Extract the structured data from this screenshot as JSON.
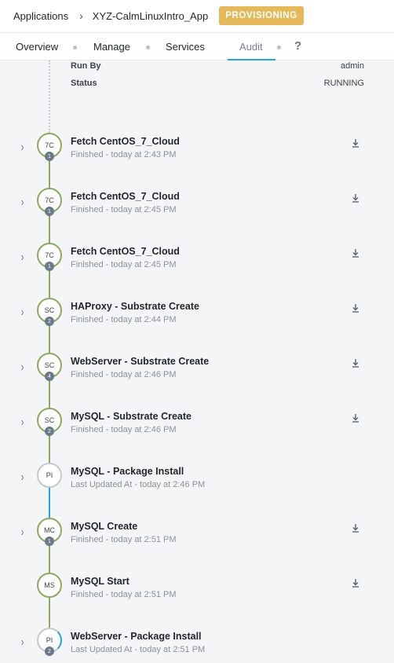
{
  "breadcrumb": {
    "root": "Applications",
    "app_name": "XYZ-CalmLinuxIntro_App",
    "status": "PROVISIONING"
  },
  "tabs": [
    {
      "label": "Overview",
      "active": false
    },
    {
      "label": "Manage",
      "active": false
    },
    {
      "label": "Services",
      "active": false
    },
    {
      "label": "Audit",
      "active": true
    }
  ],
  "help_label": "?",
  "meta": {
    "run_by_label": "Run By",
    "run_by_value": "admin",
    "status_label": "Status",
    "status_value": "RUNNING"
  },
  "tasks": [
    {
      "abbr": "7C",
      "count": "1",
      "title": "Fetch CentOS_7_Cloud",
      "subtitle": "Finished - today at 2:43 PM",
      "expandable": true,
      "download": true,
      "kind": "task"
    },
    {
      "abbr": "7C",
      "count": "1",
      "title": "Fetch CentOS_7_Cloud",
      "subtitle": "Finished - today at 2:45 PM",
      "expandable": true,
      "download": true,
      "kind": "task"
    },
    {
      "abbr": "7C",
      "count": "1",
      "title": "Fetch CentOS_7_Cloud",
      "subtitle": "Finished - today at 2:45 PM",
      "expandable": true,
      "download": true,
      "kind": "task"
    },
    {
      "abbr": "SC",
      "count": "2",
      "title": "HAProxy - Substrate Create",
      "subtitle": "Finished - today at 2:44 PM",
      "expandable": true,
      "download": true,
      "kind": "task"
    },
    {
      "abbr": "SC",
      "count": "4",
      "title": "WebServer - Substrate Create",
      "subtitle": "Finished - today at 2:46 PM",
      "expandable": true,
      "download": true,
      "kind": "task"
    },
    {
      "abbr": "SC",
      "count": "2",
      "title": "MySQL - Substrate Create",
      "subtitle": "Finished - today at 2:46 PM",
      "expandable": true,
      "download": true,
      "kind": "task"
    },
    {
      "abbr": "PI",
      "count": "",
      "title": "MySQL - Package Install",
      "subtitle": "Last Updated At - today at 2:46 PM",
      "expandable": true,
      "download": false,
      "kind": "package"
    },
    {
      "abbr": "MC",
      "count": "1",
      "title": "MySQL Create",
      "subtitle": "Finished - today at 2:51 PM",
      "expandable": true,
      "download": true,
      "kind": "task"
    },
    {
      "abbr": "MS",
      "count": "",
      "title": "MySQL Start",
      "subtitle": "Finished - today at 2:51 PM",
      "expandable": false,
      "download": true,
      "kind": "task"
    },
    {
      "abbr": "PI",
      "count": "2",
      "title": "WebServer - Package Install",
      "subtitle": "Last Updated At - today at 2:51 PM",
      "expandable": true,
      "download": false,
      "kind": "package-active"
    }
  ],
  "colors": {
    "status_tag": "#e5b85a",
    "accent_blue": "#29a3e0",
    "timeline_green": "#8da860"
  },
  "icons": {
    "expand": "chevron-right-icon",
    "download": "download-icon"
  }
}
